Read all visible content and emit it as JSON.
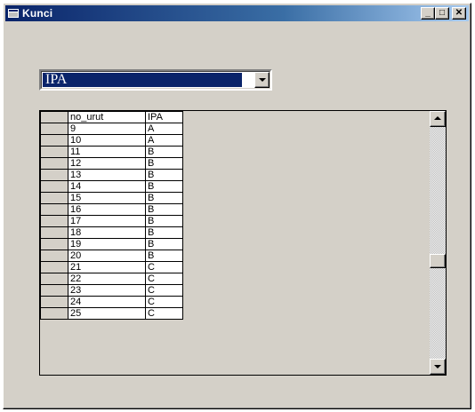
{
  "window": {
    "title": "Kunci",
    "minimize": "_",
    "maximize": "□",
    "close": "✕"
  },
  "combo": {
    "value": "IPA"
  },
  "grid": {
    "headers": {
      "no_urut": "no_urut",
      "ipa": "IPA"
    },
    "rows": [
      {
        "no_urut": "9",
        "ipa": "A"
      },
      {
        "no_urut": "10",
        "ipa": "A"
      },
      {
        "no_urut": "11",
        "ipa": "B"
      },
      {
        "no_urut": "12",
        "ipa": "B"
      },
      {
        "no_urut": "13",
        "ipa": "B"
      },
      {
        "no_urut": "14",
        "ipa": "B"
      },
      {
        "no_urut": "15",
        "ipa": "B"
      },
      {
        "no_urut": "16",
        "ipa": "B"
      },
      {
        "no_urut": "17",
        "ipa": "B"
      },
      {
        "no_urut": "18",
        "ipa": "B"
      },
      {
        "no_urut": "19",
        "ipa": "B"
      },
      {
        "no_urut": "20",
        "ipa": "B"
      },
      {
        "no_urut": "21",
        "ipa": "C"
      },
      {
        "no_urut": "22",
        "ipa": "C"
      },
      {
        "no_urut": "23",
        "ipa": "C"
      },
      {
        "no_urut": "24",
        "ipa": "C"
      },
      {
        "no_urut": "25",
        "ipa": "C"
      }
    ]
  }
}
